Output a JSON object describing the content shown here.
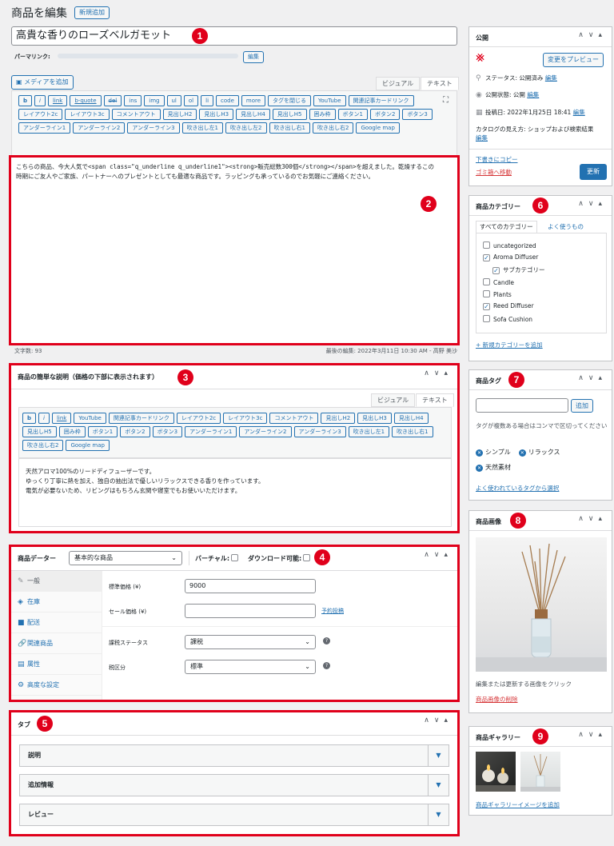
{
  "header": {
    "title": "商品を編集",
    "add_new": "新規追加"
  },
  "post": {
    "title": "高貴な香りのローズベルガモット",
    "permalink_label": "パーマリンク:",
    "permalink_edit": "編集",
    "media_button": "メディアを追加",
    "tab_visual": "ビジュアル",
    "tab_text": "テキスト"
  },
  "quicktags": [
    "b",
    "i",
    "link",
    "b-quote",
    "del",
    "ins",
    "img",
    "ul",
    "ol",
    "li",
    "code",
    "more",
    "タグを閉じる",
    "YouTube",
    "関連記事カードリンク",
    "レイアウト2c",
    "レイアウト3c",
    "コメントアウト",
    "見出しH2",
    "見出しH3",
    "見出しH4",
    "見出しH5",
    "囲み枠",
    "ボタン1",
    "ボタン2",
    "ボタン3",
    "アンダーライン1",
    "アンダーライン2",
    "アンダーライン3",
    "吹き出し左1",
    "吹き出し左2",
    "吹き出し右1",
    "吹き出し右2",
    "Google map"
  ],
  "content": {
    "text": "こちらの商品、今大人気で<span class=\"q_underline q_underline1\"><strong>販売総数300個</strong></span>を超えました。乾燥するこの時期にご友人やご家族、パートナーへのプレゼントとしても最適な商品です。ラッピングも承っているのでお気軽にご連絡ください。",
    "word_count": "文字数: 93",
    "last_edit": "最後の編集: 2022年3月11日 10:30 AM - 高野 美沙"
  },
  "excerpt": {
    "title": "商品の簡単な説明（価格の下部に表示されます）",
    "quicktags": [
      "b",
      "i",
      "link",
      "YouTube",
      "関連記事カードリンク",
      "レイアウト2c",
      "レイアウト3c",
      "コメントアウト",
      "見出しH2",
      "見出しH3",
      "見出しH4",
      "見出しH5",
      "囲み枠",
      "ボタン1",
      "ボタン2",
      "ボタン3",
      "アンダーライン1",
      "アンダーライン2",
      "アンダーライン3",
      "吹き出し左1",
      "吹き出し右1",
      "吹き出し右2",
      "Google map"
    ],
    "lines": [
      "天然アロマ100%のリードディフューザーです。",
      "ゆっくり丁寧に熱を加え、独自の抽出法で優しいリラックスできる香りを作っています。",
      "電気が必要ないため、リビングはもちろん玄関や寝室でもお使いいただけます。"
    ]
  },
  "product_data": {
    "label": "商品データー",
    "type": "基本的な商品",
    "virtual": "バーチャル:",
    "download": "ダウンロード可能:",
    "tabs": [
      "一般",
      "在庫",
      "配送",
      "関連商品",
      "属性",
      "高度な設定"
    ],
    "regular_price_label": "標準価格 (¥)",
    "regular_price": "9000",
    "sale_price_label": "セール価格 (¥)",
    "schedule": "予約投稿",
    "tax_status_label": "課税ステータス",
    "tax_status": "課税",
    "tax_class_label": "税区分",
    "tax_class": "標準"
  },
  "tabs_box": {
    "title": "タブ",
    "items": [
      "説明",
      "追加情報",
      "レビュー"
    ]
  },
  "publish": {
    "title": "公開",
    "preview": "変更をプレビュー",
    "status": "ステータス: 公開済み",
    "status_edit": "編集",
    "visibility": "公開状態: 公開",
    "visibility_edit": "編集",
    "date": "投稿日: 2022年1月25日 18:41",
    "date_edit": "編集",
    "catalog": "カタログの見え方: ショップおよび検索結果",
    "catalog_edit": "編集",
    "copy": "下書きにコピー",
    "trash": "ゴミ箱へ移動",
    "update": "更新"
  },
  "categories": {
    "title": "商品カテゴリー",
    "tab_all": "すべてのカテゴリー",
    "tab_popular": "よく使うもの",
    "items": [
      {
        "name": "uncategorized",
        "checked": ""
      },
      {
        "name": "Aroma Diffuser",
        "checked": "✓"
      },
      {
        "name": "サブカテゴリー",
        "checked": "✓"
      },
      {
        "name": "Candle",
        "checked": ""
      },
      {
        "name": "Plants",
        "checked": ""
      },
      {
        "name": "Reed Diffuser",
        "checked": "✓"
      },
      {
        "name": "Sofa Cushion",
        "checked": ""
      }
    ],
    "add": "+ 新規カテゴリーを追加"
  },
  "tags": {
    "title": "商品タグ",
    "add": "追加",
    "hint": "タグが複数ある場合はコンマで区切ってください",
    "items": [
      "シンプル",
      "リラックス",
      "天然素材"
    ],
    "popular": "よく使われているタグから選択"
  },
  "image": {
    "title": "商品画像",
    "hint": "編集または更新する画像をクリック",
    "remove": "商品画像の削除"
  },
  "gallery": {
    "title": "商品ギャラリー",
    "add": "商品ギャラリーイメージを追加"
  },
  "badges": [
    "1",
    "2",
    "3",
    "4",
    "5",
    "6",
    "7",
    "8",
    "9"
  ],
  "colors": {
    "accent": "#2271b1",
    "highlight": "#e0001b"
  }
}
